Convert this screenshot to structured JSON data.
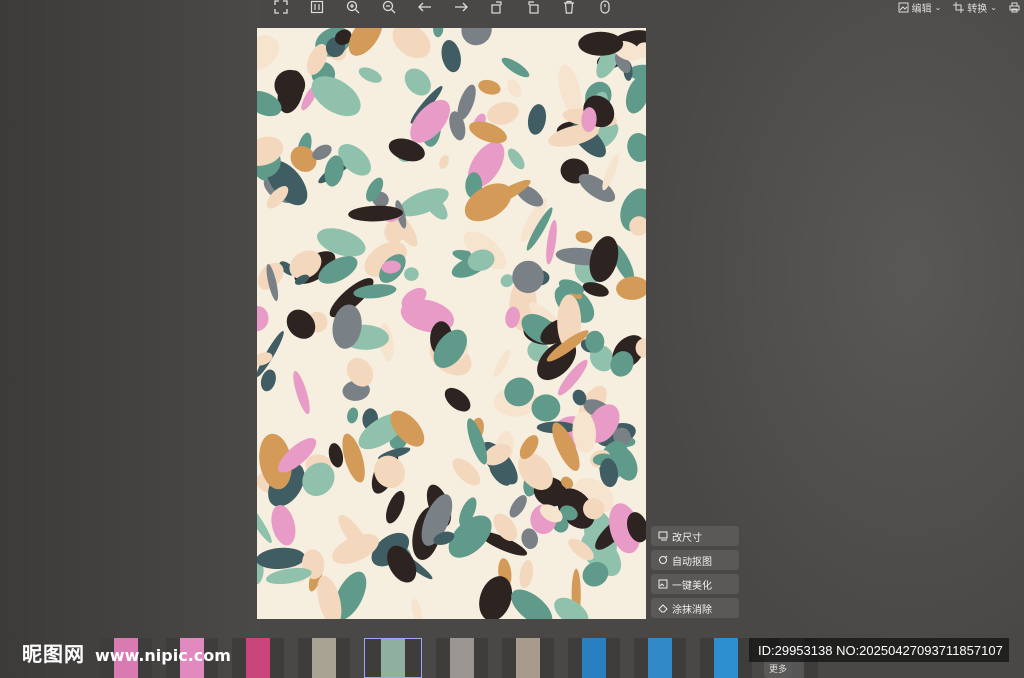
{
  "toolbar": {
    "icons": [
      "fullscreen-icon",
      "actual-size-icon",
      "zoom-in-icon",
      "zoom-out-icon",
      "previous-arrow-icon",
      "next-arrow-icon",
      "rotate-left-icon",
      "rotate-right-icon",
      "delete-icon",
      "info-icon"
    ]
  },
  "top_right": {
    "edit_label": "编辑",
    "convert_label": "转换"
  },
  "side_tools": {
    "resize_label": "改尺寸",
    "auto_cutout_label": "自动抠图",
    "beautify_label": "一键美化",
    "erase_label": "涂抹消除"
  },
  "thumbstrip": {
    "more_label": "更多",
    "count": 11
  },
  "watermark": {
    "logo_text": "昵图网",
    "url_text": "www.nipic.com"
  },
  "id_badge": {
    "text": "ID:29953138 NO:20250427093711857107"
  },
  "colors": {
    "background": "#4a4846",
    "panel_button": "#5b5957",
    "active_thumb_border": "#9aa7ff",
    "pattern_teal": "#5f9a8b",
    "pattern_peach": "#f3d8bd",
    "pattern_orange": "#d39a58",
    "pattern_pink": "#e79bc6",
    "pattern_gray": "#7a8186",
    "pattern_dark": "#2d2320"
  }
}
